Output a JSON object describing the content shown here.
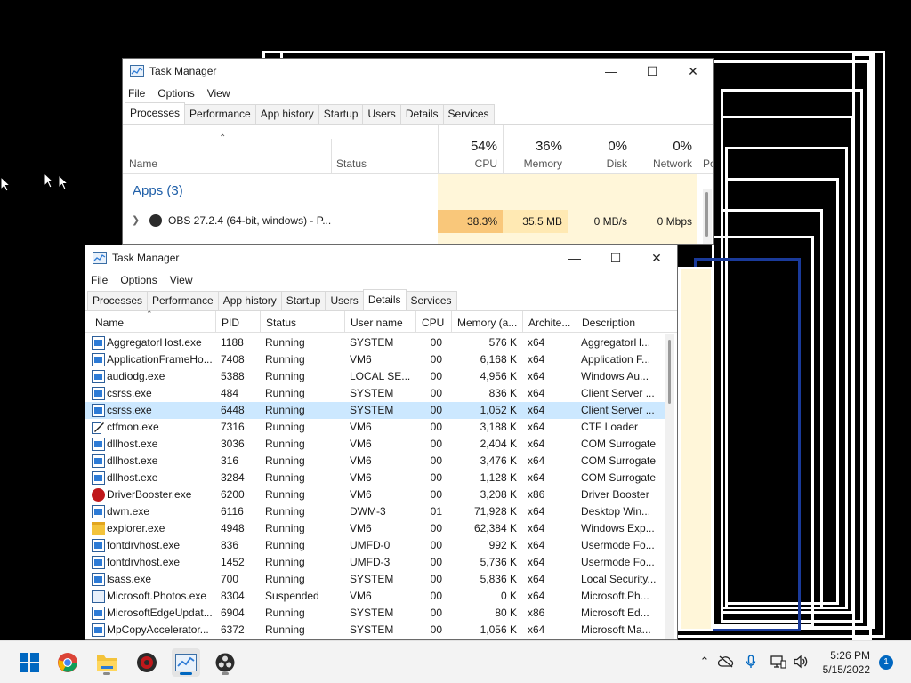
{
  "back_window": {
    "title": "Task Manager",
    "menu": [
      "File",
      "Options",
      "View"
    ],
    "tabs": [
      "Processes",
      "Performance",
      "App history",
      "Startup",
      "Users",
      "Details",
      "Services"
    ],
    "active_tab": "Processes",
    "columns": {
      "name": "Name",
      "status": "Status"
    },
    "metrics": [
      {
        "pct": "54%",
        "label": "CPU"
      },
      {
        "pct": "36%",
        "label": "Memory"
      },
      {
        "pct": "0%",
        "label": "Disk"
      },
      {
        "pct": "0%",
        "label": "Network"
      }
    ],
    "overflow_header": "Po",
    "group_label": "Apps (3)",
    "row": {
      "name": "OBS 27.2.4 (64-bit, windows) - P...",
      "cpu": "38.3%",
      "memory": "35.5 MB",
      "disk": "0 MB/s",
      "network": "0 Mbps"
    }
  },
  "front_window": {
    "title": "Task Manager",
    "menu": [
      "File",
      "Options",
      "View"
    ],
    "tabs": [
      "Processes",
      "Performance",
      "App history",
      "Startup",
      "Users",
      "Details",
      "Services"
    ],
    "active_tab": "Details",
    "columns": [
      "Name",
      "PID",
      "Status",
      "User name",
      "CPU",
      "Memory (a...",
      "Archite...",
      "Description"
    ],
    "rows": [
      {
        "icon": "app",
        "name": "AggregatorHost.exe",
        "pid": "1188",
        "status": "Running",
        "user": "SYSTEM",
        "cpu": "00",
        "mem": "576 K",
        "arch": "x64",
        "desc": "AggregatorH..."
      },
      {
        "icon": "app",
        "name": "ApplicationFrameHo...",
        "pid": "7408",
        "status": "Running",
        "user": "VM6",
        "cpu": "00",
        "mem": "6,168 K",
        "arch": "x64",
        "desc": "Application F..."
      },
      {
        "icon": "app",
        "name": "audiodg.exe",
        "pid": "5388",
        "status": "Running",
        "user": "LOCAL SE...",
        "cpu": "00",
        "mem": "4,956 K",
        "arch": "x64",
        "desc": "Windows Au..."
      },
      {
        "icon": "app",
        "name": "csrss.exe",
        "pid": "484",
        "status": "Running",
        "user": "SYSTEM",
        "cpu": "00",
        "mem": "836 K",
        "arch": "x64",
        "desc": "Client Server ..."
      },
      {
        "icon": "app",
        "name": "csrss.exe",
        "pid": "6448",
        "status": "Running",
        "user": "SYSTEM",
        "cpu": "00",
        "mem": "1,052 K",
        "arch": "x64",
        "desc": "Client Server ...",
        "selected": true
      },
      {
        "icon": "pen",
        "name": "ctfmon.exe",
        "pid": "7316",
        "status": "Running",
        "user": "VM6",
        "cpu": "00",
        "mem": "3,188 K",
        "arch": "x64",
        "desc": "CTF Loader"
      },
      {
        "icon": "app",
        "name": "dllhost.exe",
        "pid": "3036",
        "status": "Running",
        "user": "VM6",
        "cpu": "00",
        "mem": "2,404 K",
        "arch": "x64",
        "desc": "COM Surrogate"
      },
      {
        "icon": "app",
        "name": "dllhost.exe",
        "pid": "316",
        "status": "Running",
        "user": "VM6",
        "cpu": "00",
        "mem": "3,476 K",
        "arch": "x64",
        "desc": "COM Surrogate"
      },
      {
        "icon": "app",
        "name": "dllhost.exe",
        "pid": "3284",
        "status": "Running",
        "user": "VM6",
        "cpu": "00",
        "mem": "1,128 K",
        "arch": "x64",
        "desc": "COM Surrogate"
      },
      {
        "icon": "driver",
        "name": "DriverBooster.exe",
        "pid": "6200",
        "status": "Running",
        "user": "VM6",
        "cpu": "00",
        "mem": "3,208 K",
        "arch": "x86",
        "desc": "Driver Booster"
      },
      {
        "icon": "app",
        "name": "dwm.exe",
        "pid": "6116",
        "status": "Running",
        "user": "DWM-3",
        "cpu": "01",
        "mem": "71,928 K",
        "arch": "x64",
        "desc": "Desktop Win..."
      },
      {
        "icon": "folder",
        "name": "explorer.exe",
        "pid": "4948",
        "status": "Running",
        "user": "VM6",
        "cpu": "00",
        "mem": "62,384 K",
        "arch": "x64",
        "desc": "Windows Exp..."
      },
      {
        "icon": "app",
        "name": "fontdrvhost.exe",
        "pid": "836",
        "status": "Running",
        "user": "UMFD-0",
        "cpu": "00",
        "mem": "992 K",
        "arch": "x64",
        "desc": "Usermode Fo..."
      },
      {
        "icon": "app",
        "name": "fontdrvhost.exe",
        "pid": "1452",
        "status": "Running",
        "user": "UMFD-3",
        "cpu": "00",
        "mem": "5,736 K",
        "arch": "x64",
        "desc": "Usermode Fo..."
      },
      {
        "icon": "app",
        "name": "lsass.exe",
        "pid": "700",
        "status": "Running",
        "user": "SYSTEM",
        "cpu": "00",
        "mem": "5,836 K",
        "arch": "x64",
        "desc": "Local Security..."
      },
      {
        "icon": "photos",
        "name": "Microsoft.Photos.exe",
        "pid": "8304",
        "status": "Suspended",
        "user": "VM6",
        "cpu": "00",
        "mem": "0 K",
        "arch": "x64",
        "desc": "Microsoft.Ph..."
      },
      {
        "icon": "app",
        "name": "MicrosoftEdgeUpdat...",
        "pid": "6904",
        "status": "Running",
        "user": "SYSTEM",
        "cpu": "00",
        "mem": "80 K",
        "arch": "x86",
        "desc": "Microsoft Ed..."
      },
      {
        "icon": "app",
        "name": "MpCopyAccelerator...",
        "pid": "6372",
        "status": "Running",
        "user": "SYSTEM",
        "cpu": "00",
        "mem": "1,056 K",
        "arch": "x64",
        "desc": "Microsoft Ma..."
      }
    ]
  },
  "taskbar": {
    "apps": [
      "start-icon",
      "chrome-icon",
      "file-explorer-icon",
      "driver-booster-icon",
      "task-manager-icon",
      "obs-icon"
    ],
    "time": "5:26 PM",
    "date": "5/15/2022",
    "notification_count": "1"
  },
  "colors": {
    "accent": "#0067c0",
    "selected_row": "#cce8ff",
    "cpu_highlight": "#f9c77a",
    "metric_fill": "#fff6d9",
    "group_text": "#1f5fa8"
  }
}
